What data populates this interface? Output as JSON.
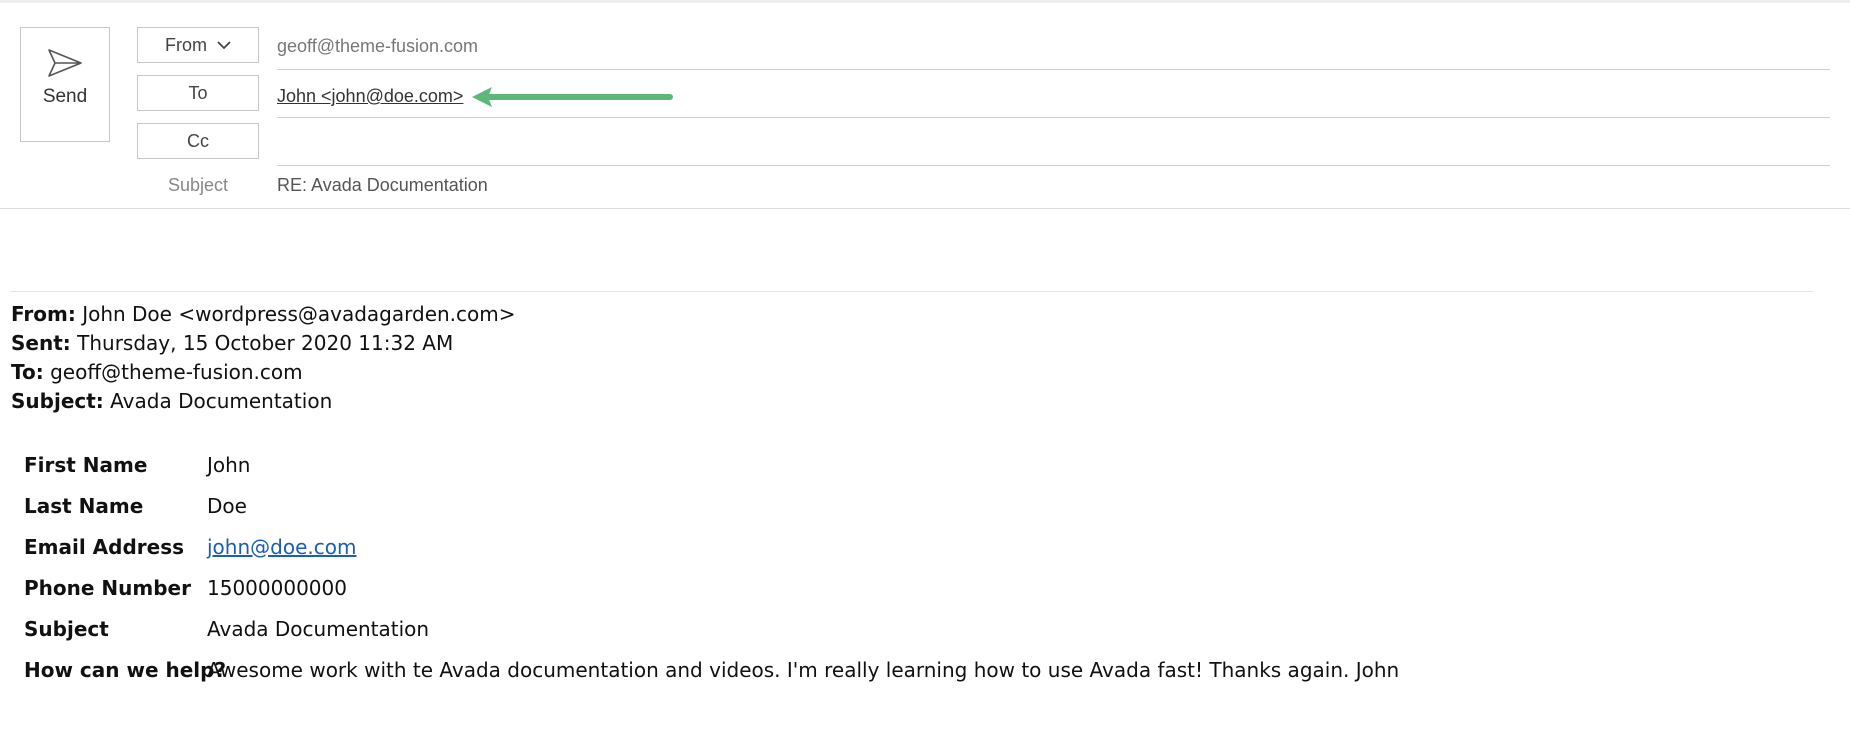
{
  "compose": {
    "send_label": "Send",
    "from_label": "From",
    "to_label": "To",
    "cc_label": "Cc",
    "subject_label": "Subject",
    "from_value": "geoff@theme-fusion.com",
    "to_value": "John <john@doe.com>",
    "cc_value": "",
    "subject_value": "RE: Avada Documentation",
    "arrow_color": "#5cb87a"
  },
  "quoted_header": {
    "from_key": "From:",
    "from_value": "John Doe <wordpress@avadagarden.com>",
    "sent_key": "Sent:",
    "sent_value": "Thursday, 15 October 2020 11:32 AM",
    "to_key": "To:",
    "to_value": "geoff@theme-fusion.com",
    "subject_key": "Subject:",
    "subject_value": "Avada Documentation"
  },
  "form_fields": [
    {
      "label": "First Name",
      "value": "John"
    },
    {
      "label": "Last Name",
      "value": "Doe"
    },
    {
      "label": "Email Address",
      "value": "john@doe.com"
    },
    {
      "label": "Phone Number",
      "value": "15000000000"
    },
    {
      "label": "Subject",
      "value": "Avada Documentation"
    },
    {
      "label": "How can we help?",
      "value": "Awesome work with te Avada documentation and videos. I'm really learning how to use Avada fast! Thanks again. John"
    }
  ],
  "colors": {
    "link": "#1a5fb4",
    "border": "#c8c8c8"
  }
}
